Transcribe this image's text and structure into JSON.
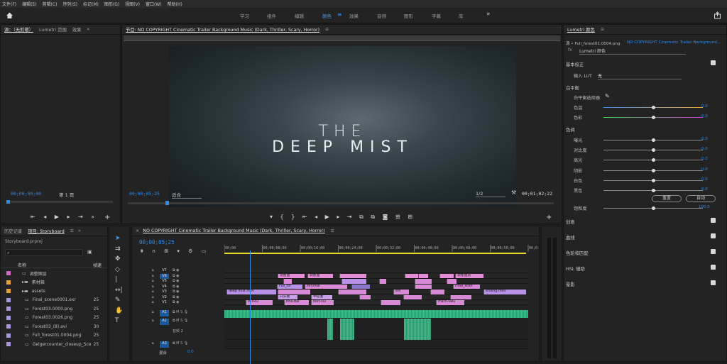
{
  "menu": [
    "文件(F)",
    "编辑(E)",
    "剪辑(C)",
    "序列(S)",
    "标记(M)",
    "图形(G)",
    "视图(V)",
    "窗口(W)",
    "帮助(H)"
  ],
  "workspaces": [
    "学习",
    "组件",
    "编辑",
    "颜色",
    "效果",
    "音频",
    "图形",
    "字幕",
    "库"
  ],
  "workspace_active": "颜色",
  "source": {
    "tabs": [
      "源：（无剪辑）",
      "Lumetri 范围",
      "效果"
    ],
    "timecode": "00;00;00;00",
    "page": "第 1 页"
  },
  "program": {
    "title": "节目: NO COPYRIGHT Cinematic Trailer Background Music (Dark, Thriller, Scary, Horror)",
    "timecode_in": "00;00;05;25",
    "fit": "适合",
    "res": "1/2",
    "duration": "00;01;02;22",
    "title_line1": "THE",
    "title_line2": "DEEP MIST"
  },
  "ruler_ticks": [
    "00;00",
    "00;00;08;00",
    "00;00;16;00",
    "00;00;24;00",
    "00;00;32;00",
    "00;00;40;00",
    "00;00;48;00",
    "00;00;56;00",
    "00;01"
  ],
  "project": {
    "tabs": [
      "历史记录",
      "项目: Storyboard"
    ],
    "file": "Storyboard.prproj",
    "col_name": "名称",
    "col_rate": "帧速",
    "items": [
      {
        "name": "调整图层",
        "color": "#d764c8",
        "rate": ""
      },
      {
        "name": "素材箱",
        "color": "#e8a030",
        "rate": ""
      },
      {
        "name": "assets",
        "color": "#e8a030",
        "rate": ""
      },
      {
        "name": "Final_scene0001.exr",
        "color": "#a894e0",
        "rate": "25"
      },
      {
        "name": "Forest03.0000.png",
        "color": "#a894e0",
        "rate": "25"
      },
      {
        "name": "Forest03.0026.png",
        "color": "#a894e0",
        "rate": "25"
      },
      {
        "name": "Forest03_(8).avi",
        "color": "#a894e0",
        "rate": "30"
      },
      {
        "name": "Full_forest01.0004.png",
        "color": "#a894e0",
        "rate": "25"
      },
      {
        "name": "Geigercounter_closeup_Sce",
        "color": "#a894e0",
        "rate": "25"
      }
    ]
  },
  "timeline": {
    "title": "NO COPYRIGHT Cinematic Trailer Background Music (Dark, Thriller, Scary, Horror)",
    "timecode": "00;00;05;25",
    "tracks": [
      "V7",
      "V6",
      "V5",
      "V4",
      "V3",
      "V2",
      "V1",
      "A1",
      "A2",
      "A3"
    ],
    "a2_label": "音频 2",
    "mix_label": "混合",
    "mix_val": "0.0",
    "clip_labels": {
      "adj1": "调整图",
      "adj2": "调整图",
      "adj3": "调整图",
      "adj4": "调整图层",
      "full": "Full_for",
      "minimal": "Minimal",
      "final": "Final_scen",
      "deep": "deep mist.mov",
      "ending": "ending.mov",
      "intro": "INTRO",
      "title": "title-bal",
      "text": "text-sui",
      "kaitou": "开头素",
      "zhongduan": "中段素",
      "mathvalue": "math-valu",
      "sth": "sth"
    }
  },
  "lumetri": {
    "title": "Lumetri 颜色",
    "source": "源 • Full_forest01.0004.png",
    "seq": "NO COPYRIGHT Cinematic Trailer Background...",
    "fx": "Lumetri 颜色",
    "basic": "基本校正",
    "lut_label": "输入 LUT",
    "lut_val": "无",
    "wb": "白平衡",
    "wb_picker": "白平衡选择器",
    "temp": {
      "label": "色温",
      "val": "0.0"
    },
    "tint": {
      "label": "色彩",
      "val": "0.0"
    },
    "tone": "色调",
    "tones": [
      {
        "label": "曝光",
        "val": "0.0"
      },
      {
        "label": "对比度",
        "val": "0.0"
      },
      {
        "label": "高光",
        "val": "0.0"
      },
      {
        "label": "阴影",
        "val": "0.0"
      },
      {
        "label": "白色",
        "val": "0.0"
      },
      {
        "label": "黑色",
        "val": "0.0"
      }
    ],
    "reset": "重置",
    "auto": "自动",
    "sat": {
      "label": "饱和度",
      "val": "100.0"
    },
    "sections": [
      "创意",
      "曲线",
      "色轮和匹配",
      "HSL 辅助",
      "晕影"
    ]
  },
  "colors": {
    "accent": "#2d8ceb",
    "video_clip": "#d98ad6",
    "audio_clip": "#3fbf8e",
    "adj_clip": "#e48ed8",
    "v_clip_alt": "#b892e8"
  }
}
